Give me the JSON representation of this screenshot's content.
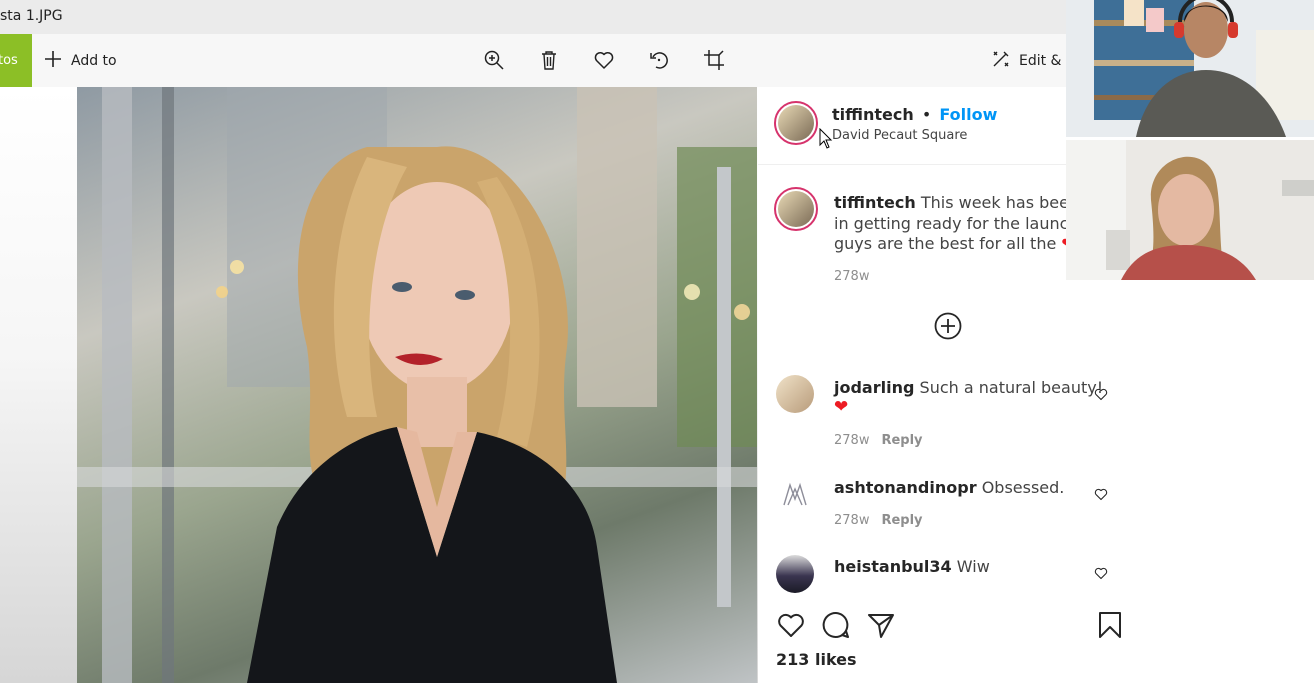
{
  "window": {
    "title": "sta 1.JPG"
  },
  "toolbar": {
    "photos_label": "tos",
    "add_to_label": "Add to",
    "edit_label": "Edit & C"
  },
  "post": {
    "username": "tiffintech",
    "separator": "•",
    "follow_label": "Follow",
    "location": "David Pecaut Square",
    "caption_lines": [
      "This week has been exc",
      "in getting ready for the launch",
      "guys are the best for all the"
    ],
    "caption_emoji_1": "🎉",
    "caption_emoji_2": "❤",
    "caption_age": "278w",
    "likes": "213 likes"
  },
  "comments": [
    {
      "user": "jodarling",
      "text": "Such a natural beauty!",
      "emoji": "❤",
      "age": "278w",
      "reply": "Reply"
    },
    {
      "user": "ashtonandinopr",
      "text": "Obsessed.",
      "age": "278w",
      "reply": "Reply"
    },
    {
      "user": "heistanbul34",
      "text": "Wiw"
    }
  ],
  "colors": {
    "accent_green": "#8cbf26",
    "follow_blue": "#0095f6",
    "heart_red": "#ed1c24",
    "story_ring": "#d6336c"
  },
  "icons": [
    "add-icon",
    "zoom-in-icon",
    "delete-icon",
    "favorite-icon",
    "rotate-icon",
    "crop-icon",
    "edit-icon",
    "add-comments-icon",
    "like-icon",
    "comment-icon",
    "share-icon",
    "bookmark-icon"
  ]
}
